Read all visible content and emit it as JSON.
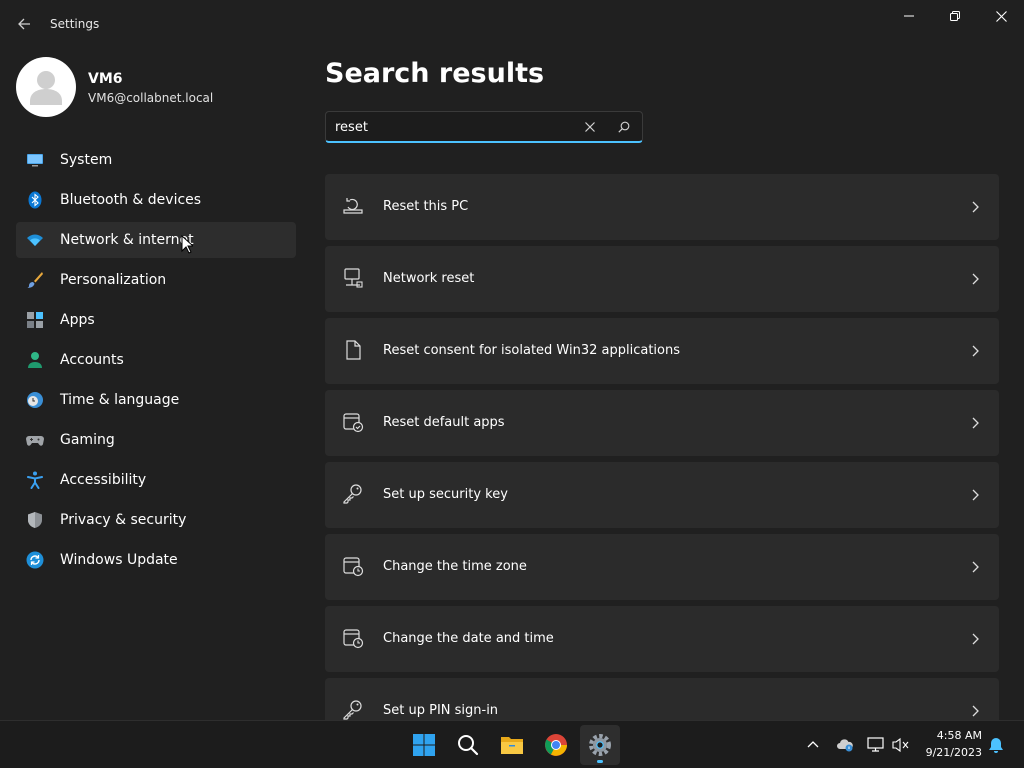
{
  "window": {
    "title": "Settings"
  },
  "profile": {
    "name": "VM6",
    "email": "VM6@collabnet.local"
  },
  "sidebar": {
    "items": [
      {
        "label": "System",
        "icon": "monitor-icon"
      },
      {
        "label": "Bluetooth & devices",
        "icon": "bluetooth-icon"
      },
      {
        "label": "Network & internet",
        "icon": "wifi-icon"
      },
      {
        "label": "Personalization",
        "icon": "brush-icon"
      },
      {
        "label": "Apps",
        "icon": "apps-icon"
      },
      {
        "label": "Accounts",
        "icon": "person-icon"
      },
      {
        "label": "Time & language",
        "icon": "globe-clock-icon"
      },
      {
        "label": "Gaming",
        "icon": "gamepad-icon"
      },
      {
        "label": "Accessibility",
        "icon": "accessibility-icon"
      },
      {
        "label": "Privacy & security",
        "icon": "shield-icon"
      },
      {
        "label": "Windows Update",
        "icon": "update-icon"
      }
    ]
  },
  "main": {
    "title": "Search results",
    "search": {
      "value": "reset"
    },
    "results": [
      {
        "label": "Reset this PC",
        "icon": "recovery-icon"
      },
      {
        "label": "Network reset",
        "icon": "network-computer-icon"
      },
      {
        "label": "Reset consent for isolated Win32 applications",
        "icon": "document-icon"
      },
      {
        "label": "Reset default apps",
        "icon": "default-apps-icon"
      },
      {
        "label": "Set up security key",
        "icon": "key-icon"
      },
      {
        "label": "Change the time zone",
        "icon": "calendar-clock-icon"
      },
      {
        "label": "Change the date and time",
        "icon": "calendar-clock-icon"
      },
      {
        "label": "Set up PIN sign-in",
        "icon": "key-icon"
      }
    ]
  },
  "taskbar": {
    "apps": [
      "start-icon",
      "search-icon",
      "file-explorer-icon",
      "chrome-icon",
      "settings-icon"
    ],
    "tray": [
      "chevron-up-icon",
      "onedrive-icon",
      "display-icon",
      "volume-muted-icon"
    ],
    "time": "4:58 AM",
    "date": "9/21/2023"
  },
  "colors": {
    "background": "#202020",
    "card": "#2b2b2b",
    "accent": "#4cc2ff",
    "taskbar": "#1c1c1c"
  }
}
